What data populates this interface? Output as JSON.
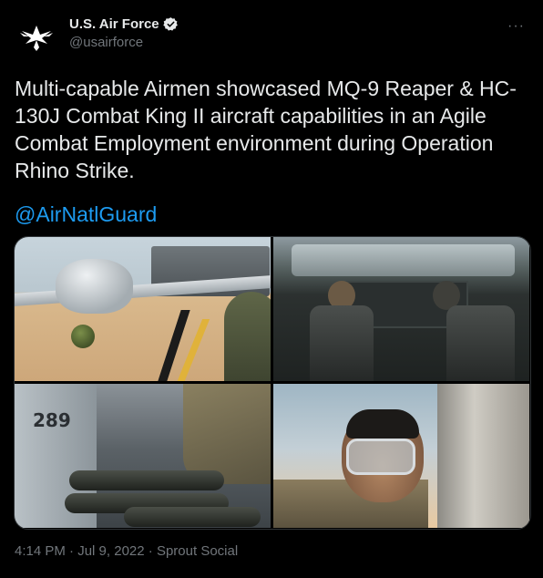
{
  "account": {
    "display_name": "U.S. Air Force",
    "handle": "@usairforce",
    "verified": true,
    "avatar_icon": "air-force-wings-icon"
  },
  "more_icon": "more-horizontal-icon",
  "tweet_text": "Multi-capable Airmen showcased MQ-9 Reaper & HC-130J Combat King II aircraft capabilities in an Agile Combat Employment environment during Operation Rhino Strike.",
  "mention": "@AirNatlGuard",
  "photo_label": "289",
  "footer": {
    "time": "4:14 PM",
    "separator1": "·",
    "date": "Jul 9, 2022",
    "separator2": "·",
    "source": "Sprout Social"
  },
  "colors": {
    "background": "#000000",
    "text": "#e7e9ea",
    "muted": "#71767b",
    "link": "#1d9bf0"
  }
}
